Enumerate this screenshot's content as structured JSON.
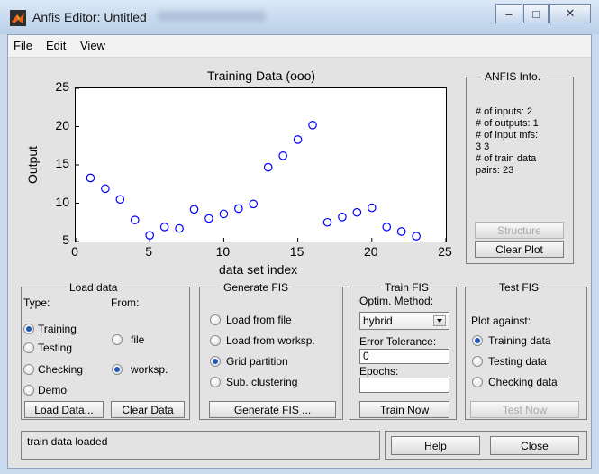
{
  "window": {
    "title": "Anfis Editor: Untitled",
    "minimize_glyph": "–",
    "maximize_glyph": "□",
    "close_glyph": "✕"
  },
  "menu": [
    "File",
    "Edit",
    "View"
  ],
  "chart_data": {
    "type": "scatter",
    "title": "Training Data (ooo)",
    "xlabel": "data set index",
    "ylabel": "Output",
    "xlim": [
      0,
      25
    ],
    "ylim": [
      5,
      25
    ],
    "xticks": [
      "0",
      "5",
      "10",
      "15",
      "20",
      "25"
    ],
    "yticks": [
      "5",
      "10",
      "15",
      "20",
      "25"
    ],
    "marker": "circle-open",
    "color": "#0000ff",
    "series": [
      {
        "x": [
          1,
          2,
          3,
          4,
          5,
          6,
          7,
          8,
          9,
          10,
          11,
          12,
          13,
          14,
          15,
          16,
          17,
          18,
          19,
          20,
          21,
          22,
          23
        ],
        "values": [
          13.3,
          11.9,
          10.5,
          7.8,
          5.8,
          6.9,
          6.7,
          9.2,
          8,
          8.6,
          9.3,
          9.9,
          14.7,
          16.2,
          18.3,
          20.2,
          7.5,
          8.2,
          8.8,
          9.4,
          6.9,
          6.3,
          5.7
        ]
      }
    ]
  },
  "anfis_info": {
    "title": "ANFIS Info.",
    "lines": [
      "# of inputs: 2",
      "# of outputs: 1",
      "# of input mfs:",
      "3 3",
      "# of train data",
      "pairs: 23"
    ],
    "structure_button": "Structure",
    "clear_plot_button": "Clear Plot"
  },
  "load_data": {
    "title": "Load data",
    "type_label": "Type:",
    "from_label": "From:",
    "types": [
      "Training",
      "Testing",
      "Checking",
      "Demo"
    ],
    "types_selected": "Training",
    "from_options": [
      "file",
      "worksp."
    ],
    "from_selected": "worksp.",
    "load_button": "Load Data...",
    "clear_button": "Clear Data"
  },
  "generate_fis": {
    "title": "Generate FIS",
    "options": [
      "Load from file",
      "Load from worksp.",
      "Grid partition",
      "Sub. clustering"
    ],
    "selected": "Grid partition",
    "button": "Generate FIS ..."
  },
  "train_fis": {
    "title": "Train FIS",
    "optim_label": "Optim. Method:",
    "method": "hybrid",
    "error_label": "Error Tolerance:",
    "error_value": "0",
    "epochs_label": "Epochs:",
    "epochs_value": "",
    "button": "Train Now"
  },
  "test_fis": {
    "title": "Test FIS",
    "plot_label": "Plot against:",
    "options": [
      "Training data",
      "Testing data",
      "Checking data"
    ],
    "selected": "Training data",
    "button": "Test Now"
  },
  "status": {
    "message": "train data loaded",
    "help_button": "Help",
    "close_button": "Close"
  }
}
